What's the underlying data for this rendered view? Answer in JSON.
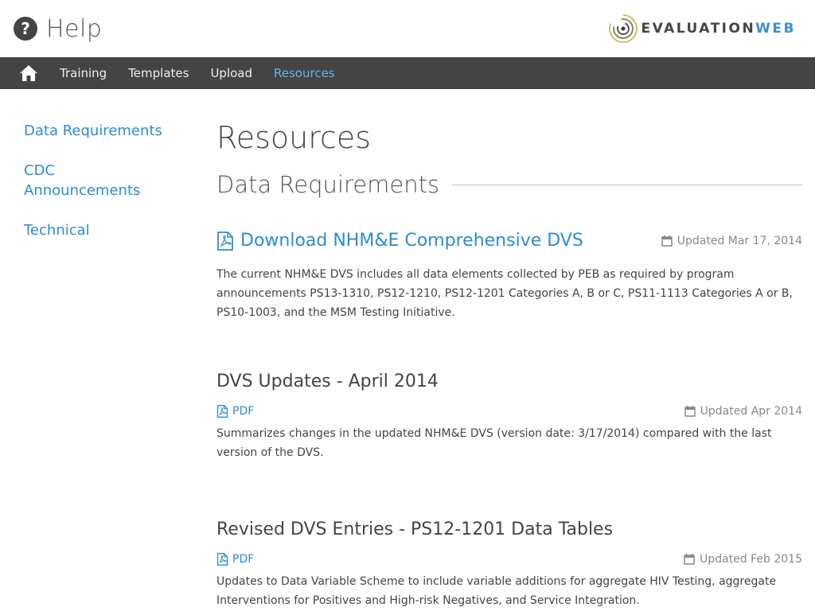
{
  "header": {
    "title": "Help",
    "icon": "question-circle-icon",
    "logo": {
      "part1": "EVALUATION",
      "part2": "WEB",
      "accent": "#3b8fd1"
    }
  },
  "nav": {
    "home_icon": "home-icon",
    "items": [
      {
        "label": "Training"
      },
      {
        "label": "Templates"
      },
      {
        "label": "Upload"
      },
      {
        "label": "Resources",
        "active": true
      }
    ],
    "background": "#444444",
    "active_color": "#66b2ea"
  },
  "sidebar": {
    "items": [
      {
        "label": "Data Requirements"
      },
      {
        "label": "CDC Announcements"
      },
      {
        "label": "Technical"
      }
    ]
  },
  "main": {
    "page_title": "Resources",
    "section_title": "Data Requirements",
    "resources": [
      {
        "title": "Download NHM&E Comprehensive DVS",
        "updated": "Updated Mar 17, 2014",
        "description": "The current NHM&E DVS includes all data elements collected by PEB as required by program announcements PS13-1310, PS12-1210, PS12-1201 Categories A, B or C, PS11-1113 Categories A or B, PS10-1003, and the MSM Testing Initiative."
      },
      {
        "title": "DVS Updates - April 2014",
        "link": "PDF",
        "updated": "Updated Apr 2014",
        "description": "Summarizes changes in the updated NHM&E DVS (version date: 3/17/2014) compared with the last version of the DVS."
      },
      {
        "title": "Revised DVS Entries - PS12-1201 Data Tables",
        "link": "PDF",
        "updated": "Updated Feb 2015",
        "description": "Updates to Data Variable Scheme to include variable additions for aggregate HIV Testing, aggregate Interventions for Positives and High-risk Negatives, and Service Integration."
      }
    ]
  }
}
